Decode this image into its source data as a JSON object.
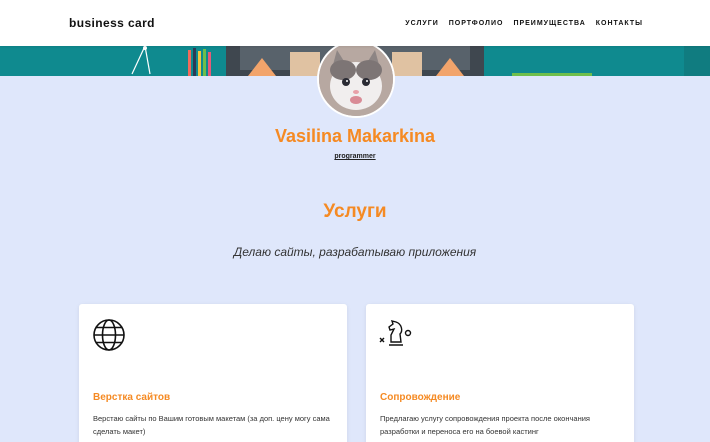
{
  "nav": {
    "brand": "business card",
    "links": [
      "УСЛУГИ",
      "ПОРТФОЛИО",
      "ПРЕИМУЩЕСТВА",
      "КОНТАКТЫ"
    ]
  },
  "profile": {
    "name": "Vasilina Makarkina",
    "role": "programmer"
  },
  "services": {
    "title": "Услуги",
    "subtitle": "Делаю сайты, разрабатываю приложения",
    "cards": [
      {
        "icon": "globe-icon",
        "title": "Верстка сайтов",
        "text": "Верстаю сайты по Вашим готовым макетам (за доп. цену могу сама сделать макет)"
      },
      {
        "icon": "chess-knight-icon",
        "title": "Сопровождение",
        "text": "Предлагаю услугу сопровождения проекта после окончания разработки и переноса его на боевой кастинг"
      }
    ]
  },
  "colors": {
    "accent": "#f58a23",
    "background": "#dfe7fb",
    "hero": "#0f8a8f"
  }
}
